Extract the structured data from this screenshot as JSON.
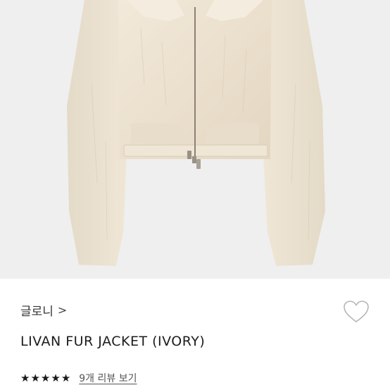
{
  "product": {
    "image_alt": "",
    "brand": "글로니",
    "brand_chevron": ">",
    "title": "LIVAN FUR JACKET (IVORY)",
    "rating_stars": 5,
    "star_glyph": "★",
    "review_link": "9개 리뷰 보기",
    "wishlist_icon": "heart-outline-icon"
  },
  "colors": {
    "image_bg": "#efefef",
    "fur": "#ede3d2",
    "text": "#222222",
    "heart_stroke": "#b5b5b5"
  }
}
